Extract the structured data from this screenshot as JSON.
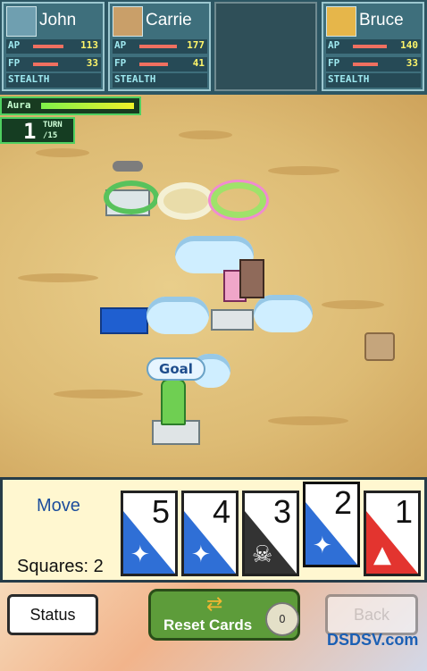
{
  "party": [
    {
      "name": "John",
      "ap": "113",
      "fp": "33",
      "stealth": "STEALTH",
      "ap_pct": 0.55,
      "fp_pct": 0.5
    },
    {
      "name": "Carrie",
      "ap": "177",
      "fp": "41",
      "stealth": "STEALTH",
      "ap_pct": 0.9,
      "fp_pct": 0.6
    },
    {
      "name": "",
      "ap": "",
      "fp": "",
      "stealth": ""
    },
    {
      "name": "Bruce",
      "ap": "140",
      "fp": "33",
      "stealth": "STEALTH",
      "ap_pct": 0.7,
      "fp_pct": 0.5
    }
  ],
  "labels": {
    "ap": "AP",
    "fp": "FP"
  },
  "aura": {
    "label": "Aura",
    "level": 0.95
  },
  "turn": {
    "current": "1",
    "label": "TURN",
    "of": "/15"
  },
  "map": {
    "goal_label": "Goal"
  },
  "card_panel": {
    "mode": "Move",
    "squares": "Squares: 2",
    "cards": [
      {
        "value": "5",
        "type": "move",
        "color": "#2f6fd6",
        "icon": "sparkle-icon"
      },
      {
        "value": "4",
        "type": "move",
        "color": "#2f6fd6",
        "icon": "sparkle-icon"
      },
      {
        "value": "3",
        "type": "skull",
        "color": "#333333",
        "icon": "skull-icon"
      },
      {
        "value": "2",
        "type": "move",
        "color": "#2f6fd6",
        "icon": "sparkle-icon"
      },
      {
        "value": "1",
        "type": "attack",
        "color": "#e3342f",
        "icon": "rocket-icon"
      }
    ]
  },
  "bottom": {
    "status_label": "Status",
    "reset_label": "Reset Cards",
    "reset_cost": "0",
    "back_label": "Back"
  },
  "watermark": "DSDSV.com"
}
